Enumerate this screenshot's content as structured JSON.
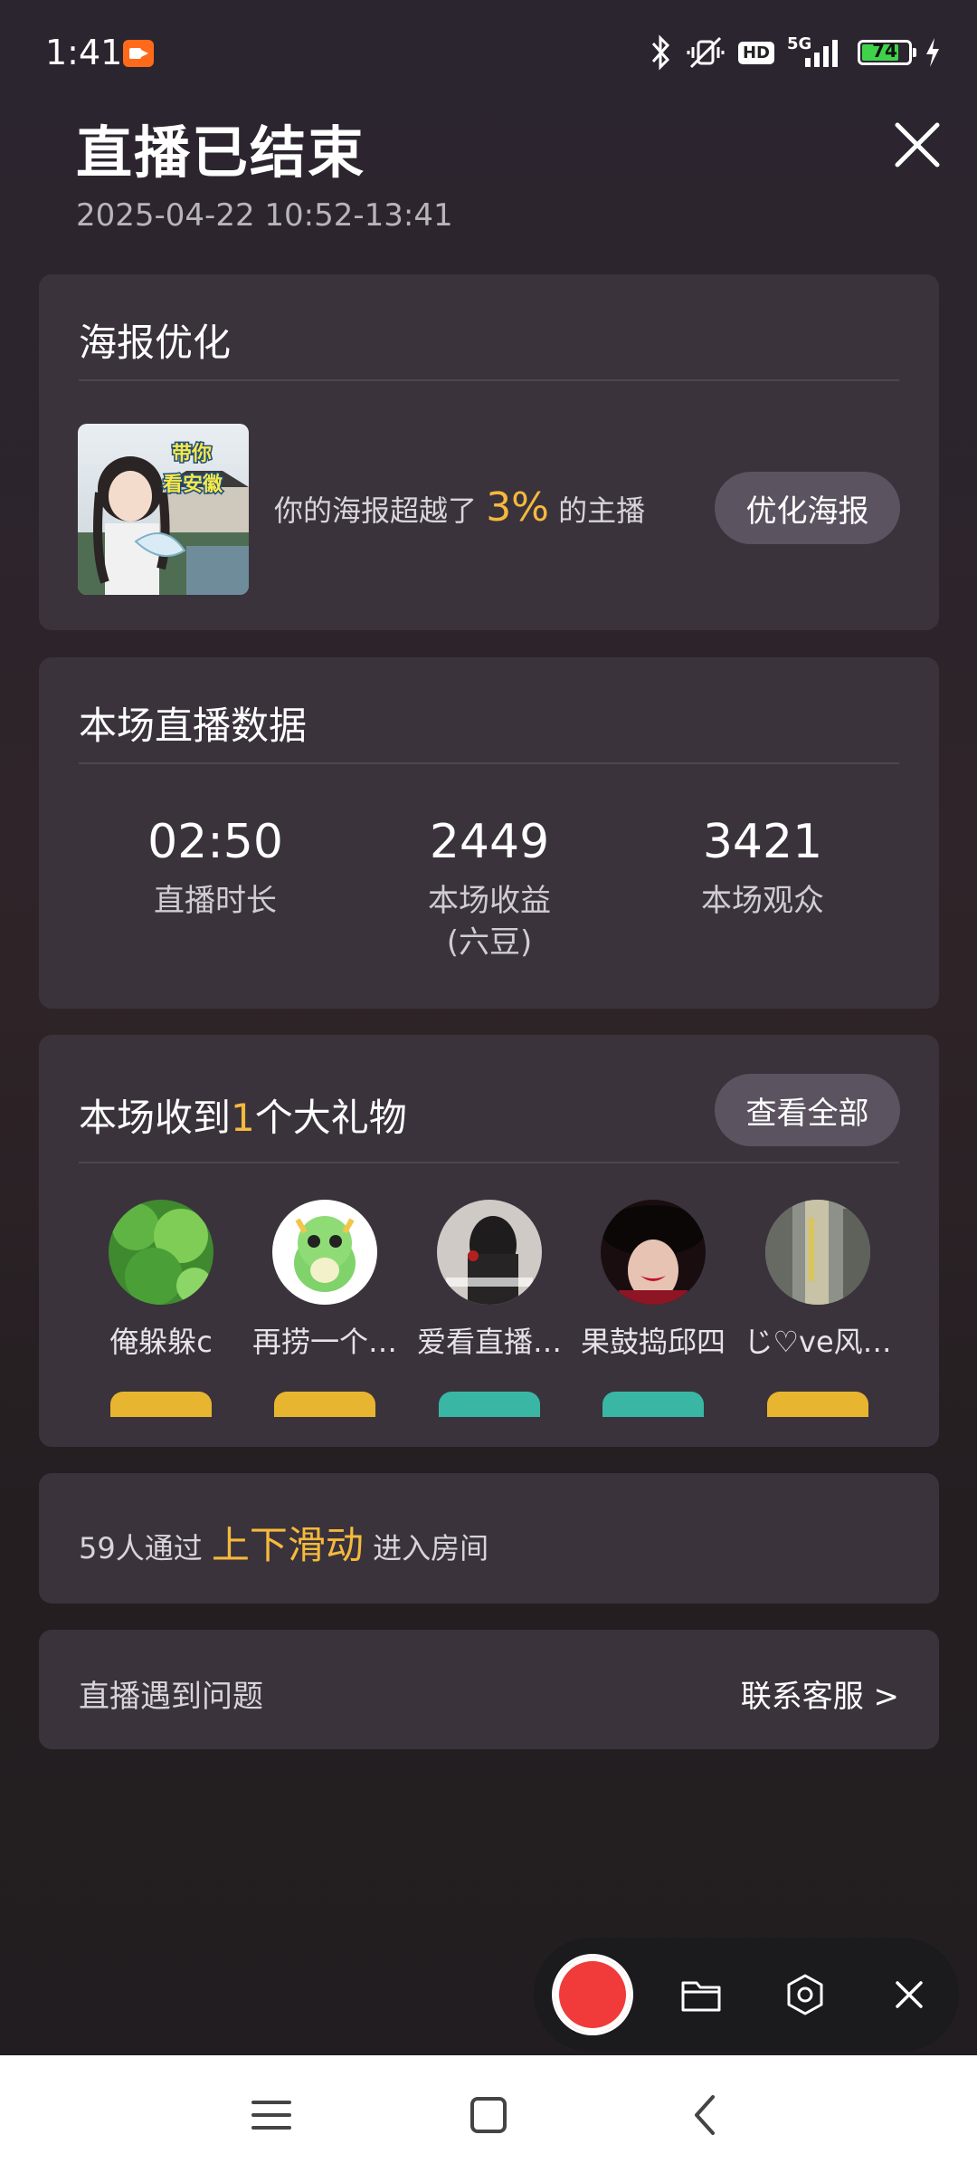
{
  "status_bar": {
    "time": "1:41",
    "network": "5G",
    "hd": "HD",
    "battery": "74"
  },
  "header": {
    "title": "直播已结束",
    "datetime": "2025-04-22 10:52-13:41"
  },
  "poster_card": {
    "title": "海报优化",
    "thumb_text_line1": "带你",
    "thumb_text_line2": "看安徽",
    "text_before": "你的海报超越了",
    "percent": "3%",
    "text_after": "的主播",
    "button": "优化海报"
  },
  "stats_card": {
    "title": "本场直播数据",
    "items": [
      {
        "value": "02:50",
        "label": "直播时长"
      },
      {
        "value": "2449",
        "label": "本场收益\n(六豆)"
      },
      {
        "value": "3421",
        "label": "本场观众"
      }
    ]
  },
  "gifts_card": {
    "title_before": "本场收到",
    "count": "1",
    "title_after": "个大礼物",
    "button": "查看全部",
    "users": [
      {
        "name": "俺躲躲c"
      },
      {
        "name": "再捞一个…"
      },
      {
        "name": "爱看直播…"
      },
      {
        "name": "果鼓捣邱四"
      },
      {
        "name": "じ♡ve风…"
      }
    ]
  },
  "slide_card": {
    "count_text": "59人通过",
    "highlight": "上下滑动",
    "suffix": "进入房间"
  },
  "problem_card": {
    "label": "直播遇到问题",
    "link": "联系客服 >"
  },
  "colors": {
    "accent": "#f5b93c",
    "card": "#3a333c",
    "record": "#f13a3a"
  }
}
